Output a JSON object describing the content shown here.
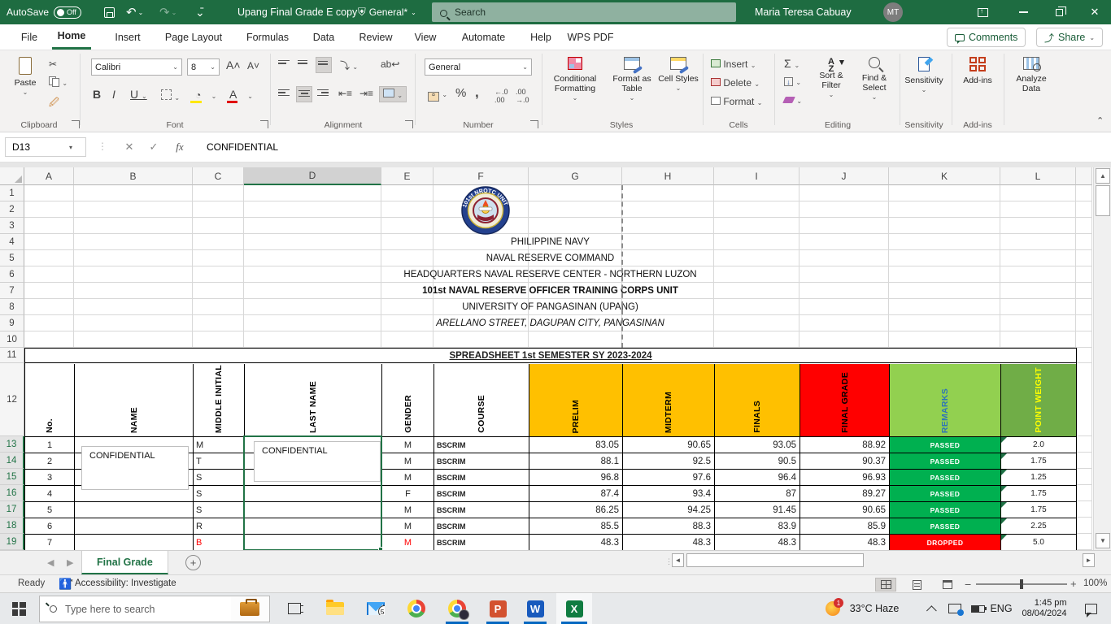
{
  "titlebar": {
    "autosave_label": "AutoSave",
    "autosave_state": "Off",
    "filename": "Upang Final Grade E copy",
    "sensitivity_badge": "General*",
    "search_placeholder": "Search",
    "user_name": "Maria Teresa Cabuay",
    "user_initials": "MT"
  },
  "menu": {
    "tabs": [
      {
        "label": "File"
      },
      {
        "label": "Home",
        "active": true
      },
      {
        "label": "Insert"
      },
      {
        "label": "Page Layout"
      },
      {
        "label": "Formulas"
      },
      {
        "label": "Data"
      },
      {
        "label": "Review"
      },
      {
        "label": "View"
      },
      {
        "label": "Automate"
      },
      {
        "label": "Help"
      },
      {
        "label": "WPS PDF"
      }
    ],
    "comments_label": "Comments",
    "share_label": "Share"
  },
  "ribbon": {
    "paste_label": "Paste",
    "font_name": "Calibri",
    "font_size": "8",
    "number_format": "General",
    "conditional_formatting": "Conditional Formatting",
    "format_as_table": "Format as Table",
    "cell_styles": "Cell Styles",
    "insert_label": "Insert",
    "delete_label": "Delete",
    "format_label": "Format",
    "sort_filter": "Sort & Filter",
    "find_select": "Find & Select",
    "sensitivity_label": "Sensitivity",
    "addins_label": "Add-ins",
    "analyze_data_label": "Analyze Data",
    "group_labels": [
      "Clipboard",
      "Font",
      "Alignment",
      "Number",
      "Styles",
      "Cells",
      "Editing",
      "Sensitivity",
      "Add-ins"
    ]
  },
  "formula_bar": {
    "cell_ref": "D13",
    "value": "CONFIDENTIAL"
  },
  "sheet": {
    "columns": [
      "A",
      "B",
      "C",
      "D",
      "E",
      "F",
      "G",
      "H",
      "I",
      "J",
      "K",
      "L"
    ],
    "rows": [
      1,
      2,
      3,
      4,
      5,
      6,
      7,
      8,
      9,
      10,
      11,
      12,
      13,
      14,
      15,
      16,
      17,
      18,
      19
    ],
    "selected_column": "D",
    "selected_rows_start": 13,
    "selected_rows_end": 19,
    "logo_text": "101st NROTC UNIT",
    "header_lines": [
      {
        "row": 4,
        "text": "PHILIPPINE NAVY"
      },
      {
        "row": 5,
        "text": "NAVAL RESERVE COMMAND"
      },
      {
        "row": 6,
        "text": "HEADQUARTERS NAVAL RESERVE CENTER - NORTHERN LUZON"
      },
      {
        "row": 7,
        "text": "101st NAVAL RESERVE OFFICER TRAINING CORPS UNIT",
        "bold": true
      },
      {
        "row": 8,
        "text": "UNIVERSITY OF PANGASINAN (UPANG)"
      },
      {
        "row": 9,
        "text": "ARELLANO STREET, DAGUPAN CITY, PANGASINAN",
        "italic": true
      }
    ],
    "table_title": "SPREADSHEET 1st SEMESTER SY 2023-2024"
  },
  "table": {
    "headers": [
      {
        "label": "No.",
        "bg": "#FFFFFF",
        "fg": "#000000"
      },
      {
        "label": "NAME",
        "bg": "#FFFFFF",
        "fg": "#000000"
      },
      {
        "label": "MIDDLE INITIAL",
        "bg": "#FFFFFF",
        "fg": "#000000"
      },
      {
        "label": "LAST NAME",
        "bg": "#FFFFFF",
        "fg": "#000000"
      },
      {
        "label": "GENDER",
        "bg": "#FFFFFF",
        "fg": "#000000"
      },
      {
        "label": "COURSE",
        "bg": "#FFFFFF",
        "fg": "#000000"
      },
      {
        "label": "PRELIM",
        "bg": "#FFC000",
        "fg": "#000000"
      },
      {
        "label": "MIDTERM",
        "bg": "#FFC000",
        "fg": "#000000"
      },
      {
        "label": "FINALS",
        "bg": "#FFC000",
        "fg": "#000000"
      },
      {
        "label": "FINAL GRADE",
        "bg": "#FF0000",
        "fg": "#000000"
      },
      {
        "label": "REMARKS",
        "bg": "#92D050",
        "fg": "#2E75B6"
      },
      {
        "label": "POINT WEIGHT",
        "bg": "#70AD47",
        "fg": "#FFFF00"
      }
    ],
    "rows": [
      {
        "no": "1",
        "middle_initial": "M",
        "gender": "M",
        "course": "BSCRIM",
        "prelim": "83.05",
        "midterm": "90.65",
        "finals": "93.05",
        "final_grade": "88.92",
        "remarks": "PASSED",
        "point_weight": "2.0"
      },
      {
        "no": "2",
        "middle_initial": "T",
        "gender": "M",
        "course": "BSCRIM",
        "prelim": "88.1",
        "midterm": "92.5",
        "finals": "90.5",
        "final_grade": "90.37",
        "remarks": "PASSED",
        "point_weight": "1.75"
      },
      {
        "no": "3",
        "middle_initial": "S",
        "gender": "M",
        "course": "BSCRIM",
        "prelim": "96.8",
        "midterm": "97.6",
        "finals": "96.4",
        "final_grade": "96.93",
        "remarks": "PASSED",
        "point_weight": "1.25"
      },
      {
        "no": "4",
        "middle_initial": "S",
        "gender": "F",
        "course": "BSCRIM",
        "prelim": "87.4",
        "midterm": "93.4",
        "finals": "87",
        "final_grade": "89.27",
        "remarks": "PASSED",
        "point_weight": "1.75"
      },
      {
        "no": "5",
        "middle_initial": "S",
        "gender": "M",
        "course": "BSCRIM",
        "prelim": "86.25",
        "midterm": "94.25",
        "finals": "91.45",
        "final_grade": "90.65",
        "remarks": "PASSED",
        "point_weight": "1.75"
      },
      {
        "no": "6",
        "middle_initial": "R",
        "gender": "M",
        "course": "BSCRIM",
        "prelim": "85.5",
        "midterm": "88.3",
        "finals": "83.9",
        "final_grade": "85.9",
        "remarks": "PASSED",
        "point_weight": "2.25"
      },
      {
        "no": "7",
        "middle_initial": "B",
        "gender": "M",
        "course": "BSCRIM",
        "prelim": "48.3",
        "midterm": "48.3",
        "finals": "48.3",
        "final_grade": "48.3",
        "remarks": "DROPPED",
        "point_weight": "5.0"
      }
    ],
    "confidential_box_name": "CONFIDENTIAL",
    "confidential_box_lastname": "CONFIDENTIAL",
    "passed_color": "#00B050",
    "dropped_color": "#FF0000"
  },
  "sheet_tabs": {
    "active_tab": "Final Grade"
  },
  "status_bar": {
    "mode": "Ready",
    "accessibility": "Accessibility: Investigate",
    "zoom_level": "100%"
  },
  "taskbar": {
    "search_placeholder": "Type here to search",
    "mail_badge": "58",
    "weather": "33°C Haze",
    "language": "ENG",
    "time": "1:45 pm",
    "date": "08/04/2024"
  }
}
